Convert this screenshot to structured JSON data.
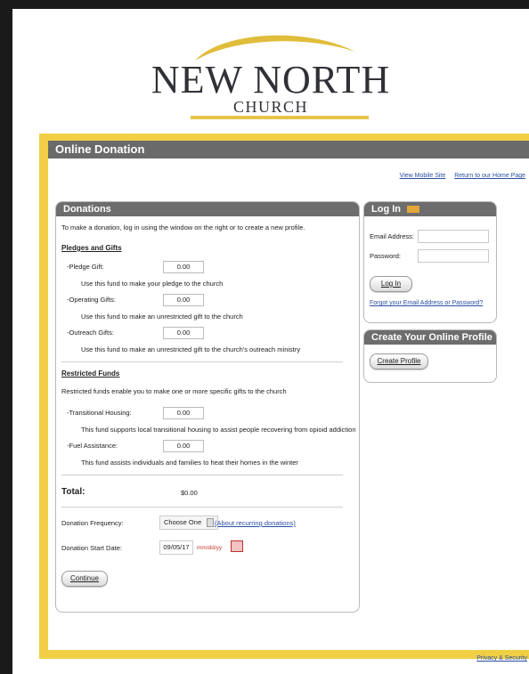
{
  "logo": {
    "line1": "NEW NORTH",
    "line2": "CHURCH"
  },
  "header": {
    "title": "Online Donation"
  },
  "toplinks": {
    "mobile": "View Mobile Site",
    "home": "Return to our Home Page"
  },
  "donations": {
    "title": "Donations",
    "intro": "To make a donation, log in using the window on the right or to create a new profile.",
    "pledges_heading": "Pledges and Gifts",
    "funds": [
      {
        "label": "-Pledge Gift:",
        "value": "0.00",
        "desc": "Use this fund to make your pledge to the church"
      },
      {
        "label": "-Operating Gifts:",
        "value": "0.00",
        "desc": "Use this fund to make an unrestricted gift to the church"
      },
      {
        "label": "-Outreach Gifts:",
        "value": "0.00",
        "desc": "Use this fund to make an unrestricted gift to the church's outreach ministry"
      }
    ],
    "restricted_heading": "Restricted Funds",
    "restricted_intro": "Restricted funds enable you to make one or more specific gifts to the church",
    "restricted_funds": [
      {
        "label": "-Transitional Housing:",
        "value": "0.00",
        "desc": "This fund supports local transitional housing to assist people recovering from opioid addiction"
      },
      {
        "label": "-Fuel Assistance:",
        "value": "0.00",
        "desc": "This fund assists individuals and families to heat their homes in the winter"
      }
    ],
    "total_label": "Total:",
    "total_value": "$0.00",
    "frequency_label": "Donation Frequency:",
    "frequency_value": "Choose One",
    "frequency_link": "(About recurring donations)",
    "start_label": "Donation Start Date:",
    "start_value": "09/05/17",
    "date_format": "mm/dd/yy",
    "continue_label": "Continue"
  },
  "login": {
    "title": "Log In",
    "email_label": "Email Address:",
    "password_label": "Password:",
    "login_button": "Log In",
    "forgot_link": "Forgot your Email Address or Password?"
  },
  "profile": {
    "title": "Create Your Online Profile",
    "button": "Create Profile"
  },
  "footer": {
    "privacy": "Privacy & Security"
  },
  "colors": {
    "frame": "#f1cf45",
    "header": "#6a6a6a",
    "link": "#2b4fa3",
    "accent_red": "#c0392b"
  }
}
